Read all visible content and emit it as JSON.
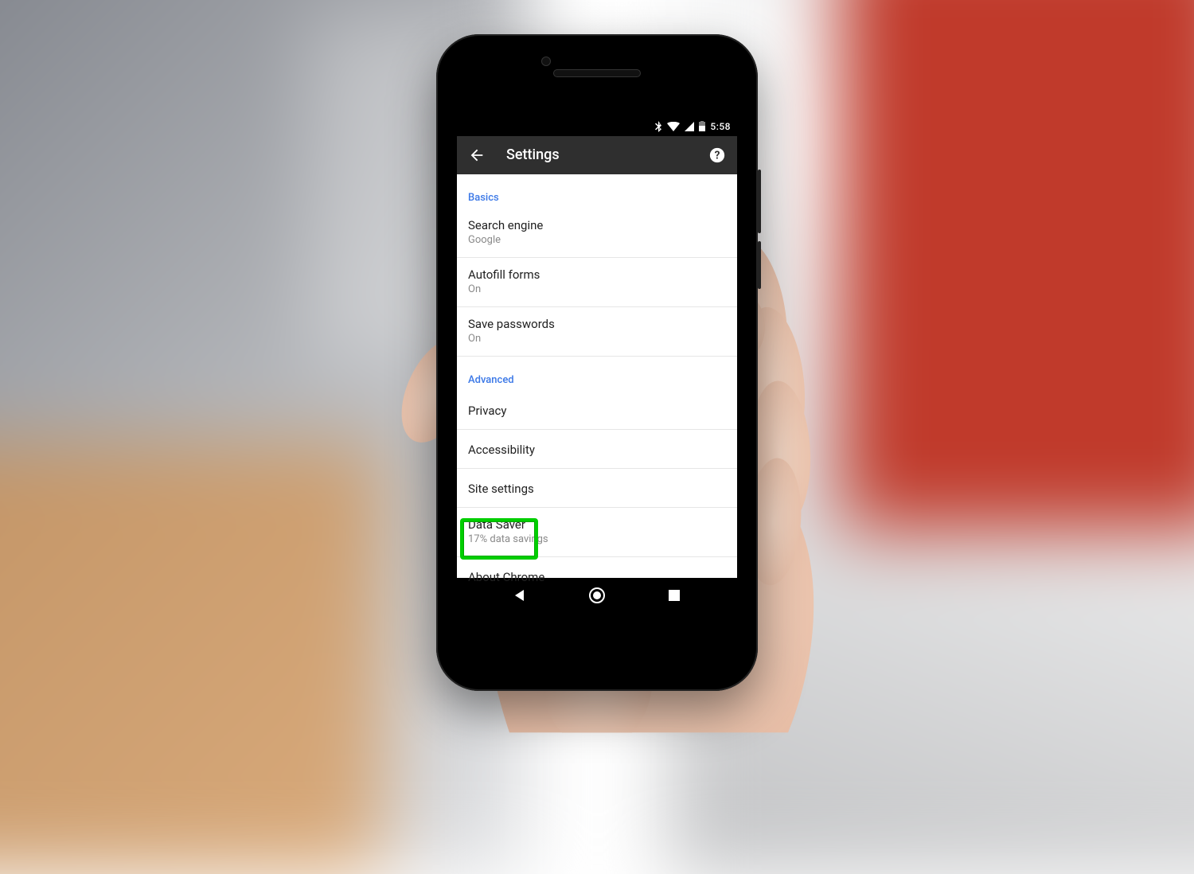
{
  "statusbar": {
    "time": "5:58"
  },
  "appbar": {
    "title": "Settings"
  },
  "sections": {
    "basics": {
      "header": "Basics",
      "search_engine": {
        "title": "Search engine",
        "value": "Google"
      },
      "autofill": {
        "title": "Autofill forms",
        "value": "On"
      },
      "save_passwords": {
        "title": "Save passwords",
        "value": "On"
      }
    },
    "advanced": {
      "header": "Advanced",
      "privacy": {
        "title": "Privacy"
      },
      "accessibility": {
        "title": "Accessibility"
      },
      "site_settings": {
        "title": "Site settings"
      },
      "data_saver": {
        "title": "Data Saver",
        "value": "17% data savings"
      },
      "about": {
        "title": "About Chrome"
      }
    }
  },
  "highlight": "site_settings"
}
